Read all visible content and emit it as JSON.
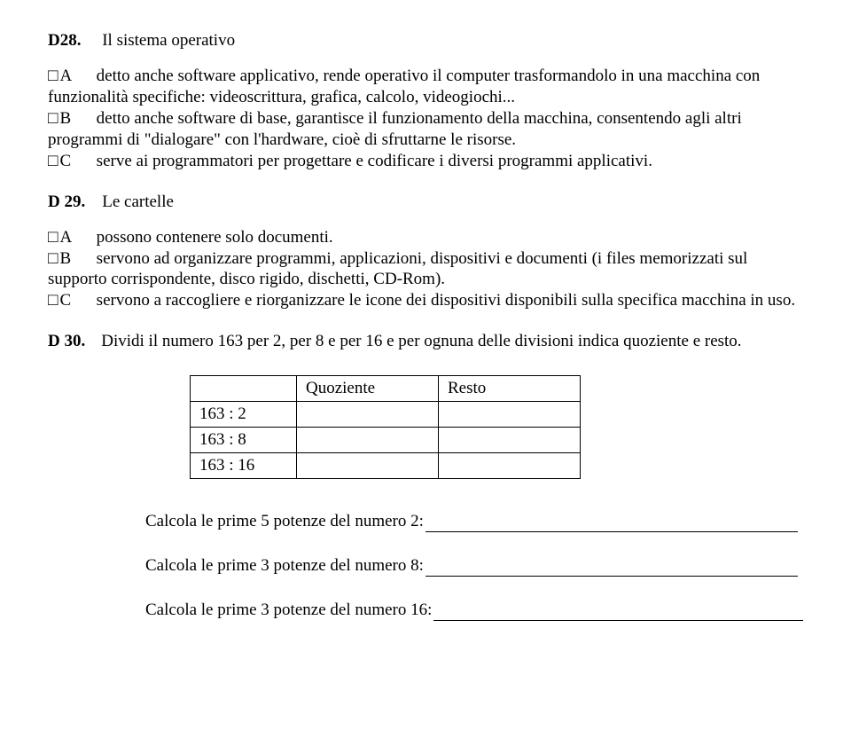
{
  "q28": {
    "num": "D28.",
    "title": "Il sistema operativo",
    "choices": {
      "A": "detto anche software applicativo, rende operativo il computer trasformandolo in una macchina con funzionalità specifiche: videoscrittura, grafica, calcolo, videogiochi...",
      "B": "detto anche software di base, garantisce il funzionamento della macchina, consentendo agli altri programmi di \"dialogare\" con l'hardware, cioè di sfruttarne le risorse.",
      "C": "serve ai programmatori per progettare e codificare i diversi programmi applicativi."
    }
  },
  "q29": {
    "num": "D 29.",
    "title": "Le cartelle",
    "choices": {
      "A": "possono contenere solo documenti.",
      "B": "servono ad organizzare programmi, applicazioni, dispositivi e documenti (i files memorizzati sul supporto corrispondente, disco rigido, dischetti, CD-Rom).",
      "C": "servono a raccogliere e riorganizzare le icone dei dispositivi disponibili sulla specifica macchina in uso."
    }
  },
  "q30": {
    "num": "D 30.",
    "text": "Dividi il numero 163 per 2, per 8 e per 16 e per ognuna delle divisioni indica quoziente e resto.",
    "table": {
      "headers": {
        "quoziente": "Quoziente",
        "resto": "Resto"
      },
      "rows": [
        "163 : 2",
        "163 : 8",
        "163 : 16"
      ]
    },
    "calc": {
      "line1": "Calcola le prime 5 potenze del numero 2:",
      "line2": "Calcola le prime 3 potenze del numero 8:",
      "line3": "Calcola le prime 3 potenze del numero 16:"
    }
  },
  "labels": {
    "A": "A",
    "B": "B",
    "C": "C"
  }
}
